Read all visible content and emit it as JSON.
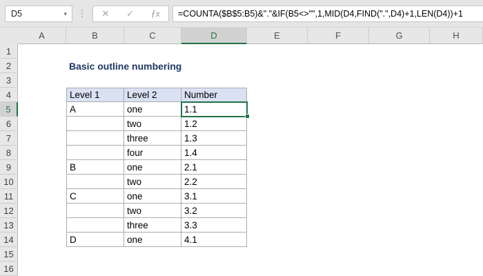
{
  "formula_bar": {
    "name_box_value": "D5",
    "formula": "=COUNTA($B$5:B5)&\".\"&IF(B5<>\"\",1,MID(D4,FIND(\".\",D4)+1,LEN(D4))+1",
    "icons": {
      "dropdown": "▾",
      "separator": "⋮",
      "cancel": "✕",
      "enter": "✓",
      "insert_function": "ƒx"
    }
  },
  "sheet": {
    "selected_cell": "D5",
    "selected_column": "D",
    "selected_row": 5,
    "column_headers": [
      "A",
      "B",
      "C",
      "D",
      "E",
      "F",
      "G",
      "H"
    ],
    "row_headers": [
      "1",
      "2",
      "3",
      "4",
      "5",
      "6",
      "7",
      "8",
      "9",
      "10",
      "11",
      "12",
      "13",
      "14",
      "15",
      "16"
    ],
    "title": "Basic outline numbering",
    "table": {
      "headers": [
        "Level 1",
        "Level 2",
        "Number"
      ],
      "rows": [
        [
          "A",
          "one",
          "1.1"
        ],
        [
          "",
          "two",
          "1.2"
        ],
        [
          "",
          "three",
          "1.3"
        ],
        [
          "",
          "four",
          "1.4"
        ],
        [
          "B",
          "one",
          "2.1"
        ],
        [
          "",
          "two",
          "2.2"
        ],
        [
          "C",
          "one",
          "3.1"
        ],
        [
          "",
          "two",
          "3.2"
        ],
        [
          "",
          "three",
          "3.3"
        ],
        [
          "D",
          "one",
          "4.1"
        ]
      ]
    }
  },
  "colors": {
    "selection_green": "#217346",
    "table_header_fill": "#D9E1F2",
    "chrome_bg": "#E6E6E6",
    "header_cell_bg": "#E7E7E7",
    "selected_header_bg": "#D2D2D2",
    "title_color": "#1F3864",
    "grid_border": "#ABABAB",
    "header_border": "#B7B7B7"
  }
}
